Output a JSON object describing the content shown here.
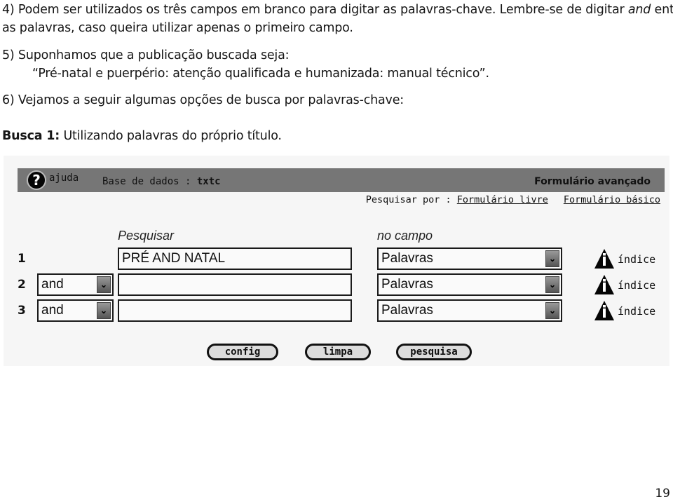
{
  "document": {
    "para4_line1_a": "4) Podem ser utilizados os três campos em branco para digitar as palavras-chave. Lembre-se de digitar ",
    "para4_line1_em": "and",
    "para4_line1_b": " entre",
    "para4_line2": "as palavras, caso queira utilizar apenas o primeiro campo.",
    "para5_line1": "5) Suponhamos que a publicação buscada seja:",
    "para5_quote": "“Pré-natal e puerpério: atenção qualificada e humanizada: manual técnico”.",
    "para6": "6) Vejamos a seguir algumas opções de busca por palavras-chave:",
    "busca_label": "Busca 1:",
    "busca_text": " Utilizando palavras do próprio título.",
    "page_number": "19"
  },
  "screenshot": {
    "topbar": {
      "help_icon": "question-mark-icon",
      "help_label": "ajuda",
      "db_label": "Base de dados : ",
      "db_value": "txtc",
      "form_title": "Formulário avançado"
    },
    "search_by": {
      "label": "Pesquisar por : ",
      "link_free": "Formulário livre",
      "link_basic": "Formulário básico"
    },
    "columns": {
      "search": "Pesquisar",
      "field": "no campo"
    },
    "rows": [
      {
        "number": "1",
        "operator": null,
        "term": "PRÉ AND NATAL",
        "field": "Palavras",
        "index_label": "índice"
      },
      {
        "number": "2",
        "operator": "and",
        "term": "",
        "field": "Palavras",
        "index_label": "índice"
      },
      {
        "number": "3",
        "operator": "and",
        "term": "",
        "field": "Palavras",
        "index_label": "índice"
      }
    ],
    "dropdown_icon": "chevron-down-icon",
    "index_icon": "warning-info-icon",
    "buttons": {
      "config": "config",
      "clear": "limpa",
      "search": "pesquisa"
    }
  }
}
